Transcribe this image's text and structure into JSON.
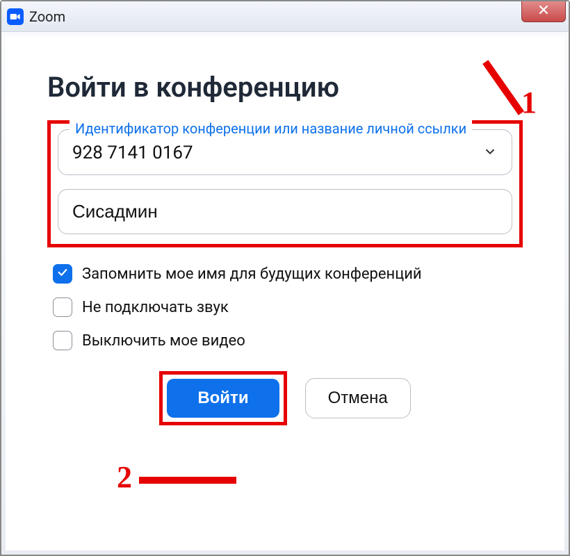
{
  "window": {
    "title": "Zoom"
  },
  "dialog": {
    "heading": "Войти в конференцию",
    "meeting_id": {
      "label": "Идентификатор конференции или название личной ссылки",
      "value": "928 7141 0167"
    },
    "name_input": {
      "value": "Сисадмин"
    },
    "checkboxes": {
      "remember_name": {
        "label": "Запомнить мое имя для будущих конференций",
        "checked": true
      },
      "no_audio": {
        "label": "Не подключать звук",
        "checked": false
      },
      "no_video": {
        "label": "Выключить мое видео",
        "checked": false
      }
    },
    "buttons": {
      "join": "Войти",
      "cancel": "Отмена"
    }
  },
  "annotations": {
    "one": "1",
    "two": "2"
  },
  "colors": {
    "accent": "#0e71eb",
    "highlight": "#e60000"
  }
}
